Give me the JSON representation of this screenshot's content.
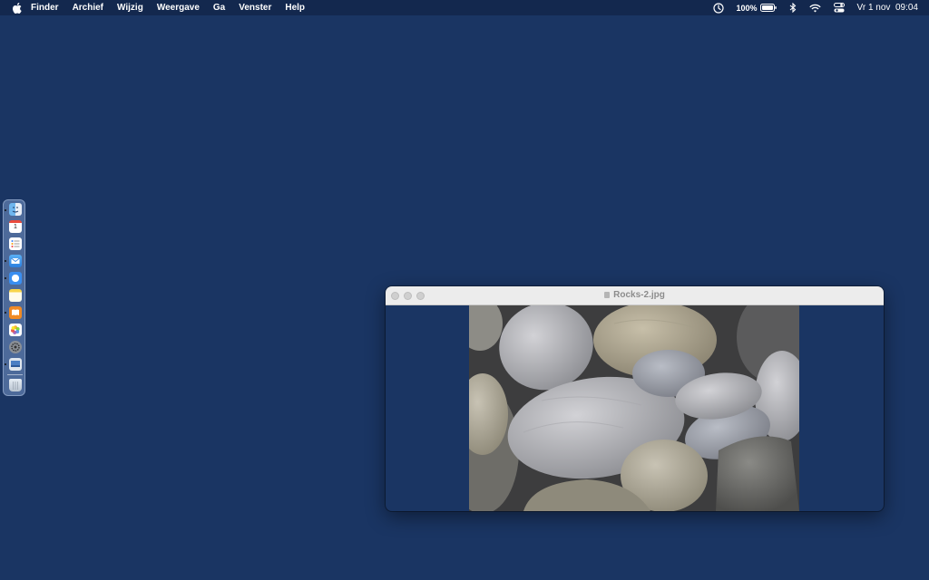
{
  "menubar": {
    "app_name": "Finder",
    "menus": [
      "Archief",
      "Wijzig",
      "Weergave",
      "Ga",
      "Venster",
      "Help"
    ],
    "battery_percent": "100%",
    "day": "Vr 1 nov",
    "time": "09:04"
  },
  "dock": {
    "apps": [
      "finder",
      "calendar",
      "reminders",
      "mail",
      "safari",
      "notes",
      "books",
      "photos",
      "system-settings",
      "preview"
    ],
    "trash": "trash",
    "calendar_day": "1"
  },
  "window": {
    "title": "Rocks-2.jpg"
  },
  "colors": {
    "desktop": "#1a3563",
    "menubar": "#13284e"
  }
}
